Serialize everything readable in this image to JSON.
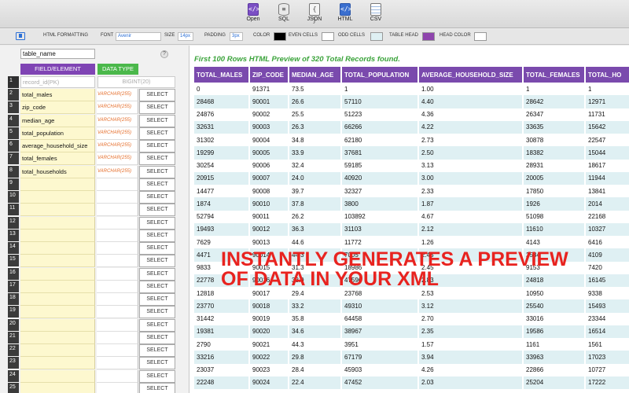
{
  "toolbar": {
    "buttons": [
      {
        "label": "Open",
        "icon": "open-icon",
        "glyph": "</>"
      },
      {
        "label": "SQL",
        "icon": "database-icon",
        "glyph": "≡"
      },
      {
        "label": "JSON",
        "icon": "json-icon",
        "glyph": "{ }"
      },
      {
        "label": "HTML",
        "icon": "html-icon",
        "glyph": "</>"
      },
      {
        "label": "CSV",
        "icon": "csv-icon",
        "glyph": ""
      }
    ]
  },
  "format_bar": {
    "html_formatting_label": "HTML FORMATTING",
    "font_label": "FONT",
    "font_value": "Avenir",
    "size_label": "SIZE",
    "size_value": "14px",
    "padding_label": "PADDING",
    "padding_value": "3px",
    "color_label": "COLOR",
    "color_value": "#000000",
    "even_cells_label": "EVEN CELLS",
    "even_cells_color": "#ffffff",
    "odd_cells_label": "ODD CELLS",
    "odd_cells_color": "#dff0f3",
    "table_head_label": "TABLE HEAD",
    "table_head_color": "#8e44ad",
    "head_color_label": "HEAD COLOR",
    "head_color_value": "#ffffff"
  },
  "schema": {
    "table_name": "table_name",
    "help_glyph": "?",
    "field_header": "FIELD/ELEMENT",
    "type_header": "DATA TYPE",
    "primary_key": {
      "num": "1",
      "name": "record_id(PK)",
      "type": "BIGINT(20)"
    },
    "select_label": "SELECT",
    "fields": [
      {
        "num": "2",
        "name": "total_males",
        "type": "VARCHAR(255)"
      },
      {
        "num": "3",
        "name": "zip_code",
        "type": "VARCHAR(255)"
      },
      {
        "num": "4",
        "name": "median_age",
        "type": "VARCHAR(255)"
      },
      {
        "num": "5",
        "name": "total_population",
        "type": "VARCHAR(255)"
      },
      {
        "num": "6",
        "name": "average_household_size",
        "type": "VARCHAR(255)"
      },
      {
        "num": "7",
        "name": "total_females",
        "type": "VARCHAR(255)"
      },
      {
        "num": "8",
        "name": "total_households",
        "type": "VARCHAR(255)"
      },
      {
        "num": "9",
        "name": "",
        "type": ""
      },
      {
        "num": "10",
        "name": "",
        "type": ""
      },
      {
        "num": "11",
        "name": "",
        "type": ""
      },
      {
        "num": "12",
        "name": "",
        "type": ""
      },
      {
        "num": "13",
        "name": "",
        "type": ""
      },
      {
        "num": "14",
        "name": "",
        "type": ""
      },
      {
        "num": "15",
        "name": "",
        "type": ""
      },
      {
        "num": "16",
        "name": "",
        "type": ""
      },
      {
        "num": "17",
        "name": "",
        "type": ""
      },
      {
        "num": "18",
        "name": "",
        "type": ""
      },
      {
        "num": "19",
        "name": "",
        "type": ""
      },
      {
        "num": "20",
        "name": "",
        "type": ""
      },
      {
        "num": "21",
        "name": "",
        "type": ""
      },
      {
        "num": "22",
        "name": "",
        "type": ""
      },
      {
        "num": "23",
        "name": "",
        "type": ""
      },
      {
        "num": "24",
        "name": "",
        "type": ""
      },
      {
        "num": "25",
        "name": "",
        "type": ""
      }
    ]
  },
  "preview": {
    "title": "First 100 Rows HTML Preview of 320 Total Records found.",
    "columns": [
      "TOTAL_MALES",
      "ZIP_CODE",
      "MEDIAN_AGE",
      "TOTAL_POPULATION",
      "AVERAGE_HOUSEHOLD_SIZE",
      "TOTAL_FEMALES",
      "TOTAL_HO"
    ],
    "rows": [
      [
        "0",
        "91371",
        "73.5",
        "1",
        "1.00",
        "1",
        "1"
      ],
      [
        "28468",
        "90001",
        "26.6",
        "57110",
        "4.40",
        "28642",
        "12971"
      ],
      [
        "24876",
        "90002",
        "25.5",
        "51223",
        "4.36",
        "26347",
        "11731"
      ],
      [
        "32631",
        "90003",
        "26.3",
        "66266",
        "4.22",
        "33635",
        "15642"
      ],
      [
        "31302",
        "90004",
        "34.8",
        "62180",
        "2.73",
        "30878",
        "22547"
      ],
      [
        "19299",
        "90005",
        "33.9",
        "37681",
        "2.50",
        "18382",
        "15044"
      ],
      [
        "30254",
        "90006",
        "32.4",
        "59185",
        "3.13",
        "28931",
        "18617"
      ],
      [
        "20915",
        "90007",
        "24.0",
        "40920",
        "3.00",
        "20005",
        "11944"
      ],
      [
        "14477",
        "90008",
        "39.7",
        "32327",
        "2.33",
        "17850",
        "13841"
      ],
      [
        "1874",
        "90010",
        "37.8",
        "3800",
        "1.87",
        "1926",
        "2014"
      ],
      [
        "52794",
        "90011",
        "26.2",
        "103892",
        "4.67",
        "51098",
        "22168"
      ],
      [
        "19493",
        "90012",
        "36.3",
        "31103",
        "2.12",
        "11610",
        "10327"
      ],
      [
        "7629",
        "90013",
        "44.6",
        "11772",
        "1.26",
        "4143",
        "6416"
      ],
      [
        "4471",
        "90014",
        "44.3",
        "7005",
        "2.45",
        "2534",
        "4109"
      ],
      [
        "9833",
        "90015",
        "31.3",
        "18986",
        "2.45",
        "9153",
        "7420"
      ],
      [
        "22778",
        "90016",
        "33.9",
        "47596",
        "2.83",
        "24818",
        "16145"
      ],
      [
        "12818",
        "90017",
        "29.4",
        "23768",
        "2.53",
        "10950",
        "9338"
      ],
      [
        "23770",
        "90018",
        "33.2",
        "49310",
        "3.12",
        "25540",
        "15493"
      ],
      [
        "31442",
        "90019",
        "35.8",
        "64458",
        "2.70",
        "33016",
        "23344"
      ],
      [
        "19381",
        "90020",
        "34.6",
        "38967",
        "2.35",
        "19586",
        "16514"
      ],
      [
        "2790",
        "90021",
        "44.3",
        "3951",
        "1.57",
        "1161",
        "1561"
      ],
      [
        "33216",
        "90022",
        "29.8",
        "67179",
        "3.94",
        "33963",
        "17023"
      ],
      [
        "23037",
        "90023",
        "28.4",
        "45903",
        "4.26",
        "22866",
        "10727"
      ],
      [
        "22248",
        "90024",
        "22.4",
        "47452",
        "2.03",
        "25204",
        "17222"
      ]
    ]
  },
  "overlay": {
    "line1": "INSTANTLY GENERATES A PREVIEW",
    "line2": "OF DATA IN YOUR XML",
    "color": "#e8231f"
  }
}
